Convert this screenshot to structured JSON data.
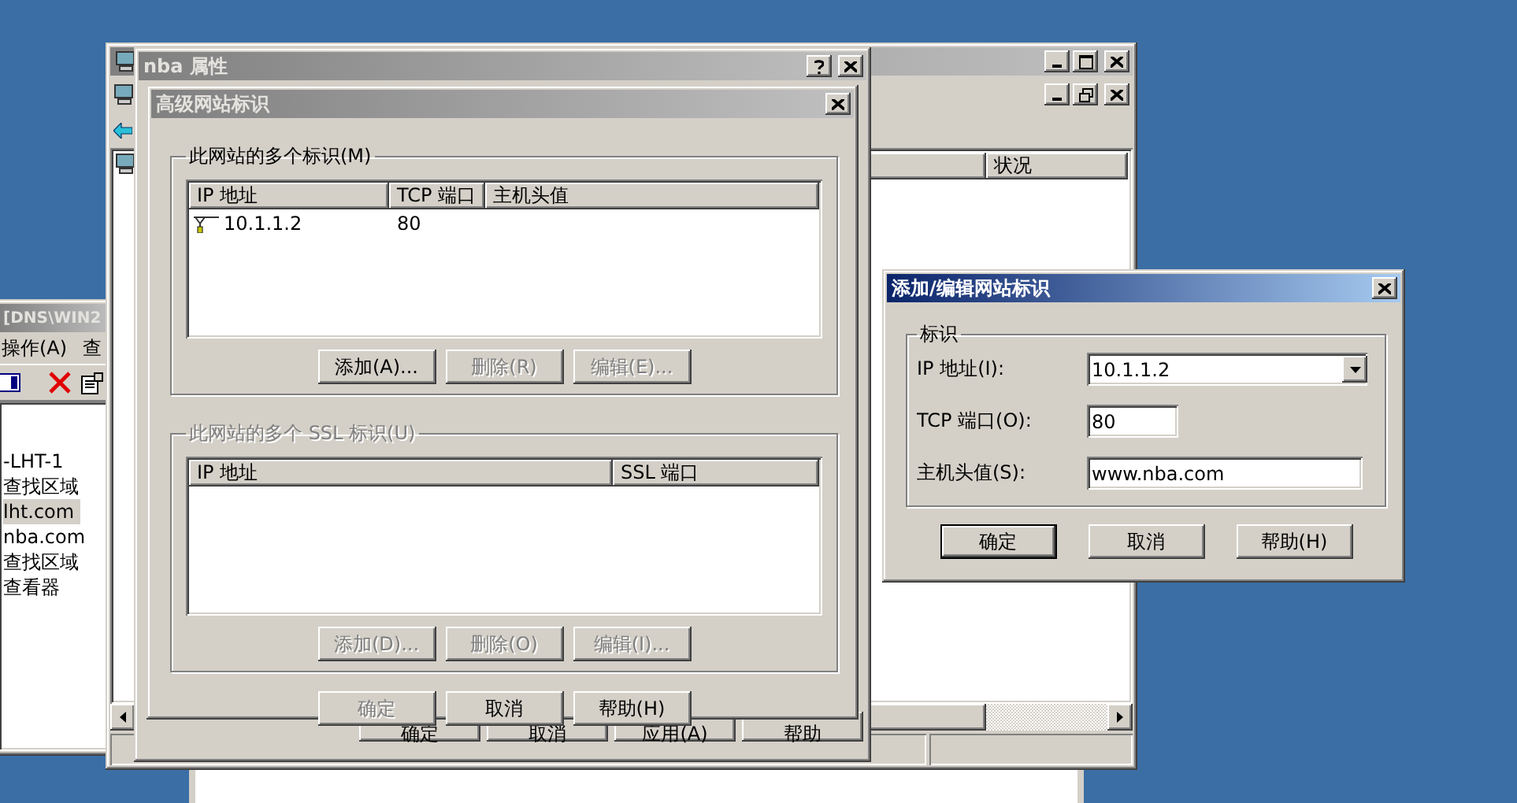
{
  "dns_window": {
    "title": "[DNS\\WIN2",
    "active": false,
    "menu": [
      "操作(A)",
      "查"
    ],
    "tree": [
      {
        "label": "-LHT-1",
        "selected": false
      },
      {
        "label": "查找区域",
        "selected": false
      },
      {
        "label": "lht.com",
        "selected": true
      },
      {
        "label": "nba.com",
        "selected": false
      },
      {
        "label": "查找区域",
        "selected": false
      },
      {
        "label": "查看器",
        "selected": false
      }
    ]
  },
  "iis_window": {
    "active": false,
    "list_columns": [
      "状况"
    ]
  },
  "properties_dialog": {
    "title": "nba 属性",
    "active": false,
    "buttons": [
      {
        "label": "确定",
        "disabled": false
      },
      {
        "label": "取消",
        "disabled": false
      },
      {
        "label": "应用(A)",
        "disabled": false
      },
      {
        "label": "帮助",
        "disabled": false
      }
    ]
  },
  "advanced_dialog": {
    "title": "高级网站标识",
    "active": false,
    "groups": [
      {
        "label": "此网站的多个标识(M)",
        "disabled": false,
        "columns": [
          "IP 地址",
          "TCP 端口",
          "主机头值"
        ],
        "rows": [
          [
            "10.1.1.2",
            "80"
          ]
        ],
        "buttons": [
          {
            "label": "添加(A)...",
            "disabled": false
          },
          {
            "label": "删除(R)",
            "disabled": true
          },
          {
            "label": "编辑(E)...",
            "disabled": true
          }
        ]
      },
      {
        "label": "此网站的多个 SSL 标识(U)",
        "disabled": true,
        "columns": [
          "IP 地址",
          "SSL 端口"
        ],
        "buttons": [
          {
            "label": "添加(D)...",
            "disabled": true
          },
          {
            "label": "删除(O)",
            "disabled": true
          },
          {
            "label": "编辑(I)...",
            "disabled": true
          }
        ]
      }
    ],
    "buttons": [
      {
        "label": "确定",
        "disabled": true
      },
      {
        "label": "取消",
        "disabled": false
      },
      {
        "label": "帮助(H)",
        "disabled": false
      }
    ]
  },
  "edit_dialog": {
    "title": "添加/编辑网站标识",
    "active": true,
    "group": "标识",
    "fields": [
      {
        "kind": "combo",
        "label": "IP 地址(I):",
        "value": "10.1.1.2"
      },
      {
        "kind": "number",
        "label": "TCP 端口(O):",
        "value": "80"
      },
      {
        "kind": "text",
        "label": "主机头值(S):",
        "value": "www.nba.com"
      }
    ],
    "buttons": [
      {
        "label": "确定",
        "default": true
      },
      {
        "label": "取消",
        "default": false
      },
      {
        "label": "帮助(H)",
        "default": false
      }
    ]
  }
}
